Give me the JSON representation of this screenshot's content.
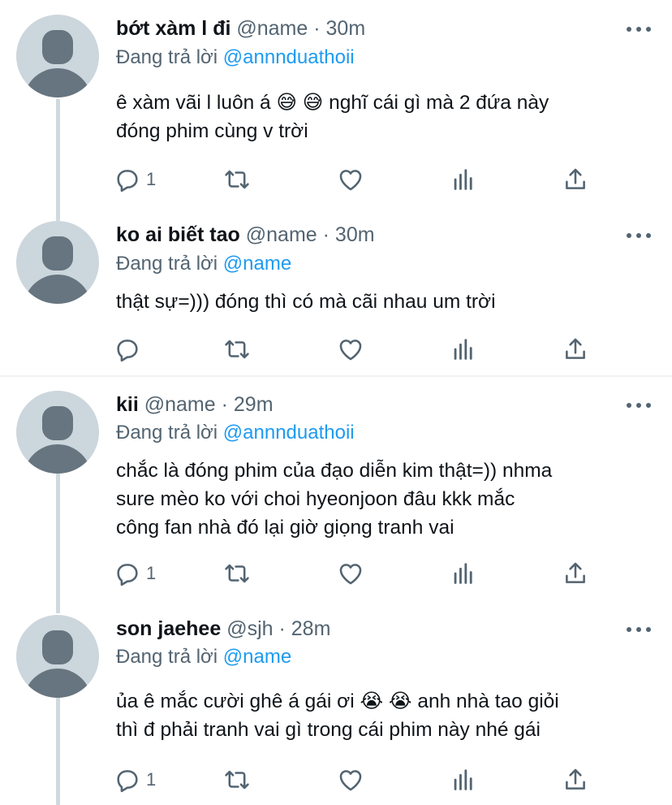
{
  "tweets": [
    {
      "name": "bớt xàm l đi",
      "handle": "@name",
      "time": "· 30m",
      "reply_prefix": "Đang trả lời",
      "reply_to": "@annnduathoii",
      "lines": [
        "ê xàm vãi l luôn á 😅 😅  nghĩ cái gì mà 2 đứa này",
        "đóng phim cùng v trời"
      ],
      "reply_count": "1"
    },
    {
      "name": "ko ai biết tao",
      "handle": "@name",
      "time": "· 30m",
      "reply_prefix": "Đang trả lời",
      "reply_to": "@name",
      "lines": [
        "thật sự=))) đóng thì có mà cãi nhau um trời"
      ],
      "reply_count": ""
    },
    {
      "name": "kii",
      "handle": "@name",
      "time": "· 29m",
      "reply_prefix": "Đang trả lời",
      "reply_to": "@annnduathoii",
      "lines": [
        "chắc là đóng phim của đạo diễn kim thật=)) nhma",
        "sure mèo ko với choi hyeonjoon đâu kkk mắc",
        "công fan nhà đó lại giờ giọng tranh vai"
      ],
      "reply_count": "1"
    },
    {
      "name": "son jaehee",
      "handle": "@sjh",
      "time": "· 28m",
      "reply_prefix": "Đang trả lời",
      "reply_to": "@name",
      "lines": [
        "ủa ê mắc cười ghê á gái ơi 😭 😭  anh nhà tao giỏi",
        "thì đ phải tranh vai gì trong cái phim này nhé gái"
      ],
      "reply_count": "1"
    }
  ],
  "icons": {
    "reply": "reply-icon",
    "retweet": "retweet-icon",
    "like": "like-icon",
    "stats": "stats-icon",
    "share": "share-icon",
    "more": "more-icon"
  },
  "colors": {
    "text": "#0f1419",
    "muted": "#536471",
    "link": "#1d9bf0",
    "avatar_bg": "#ccd6dd",
    "avatar_fg": "#66757f",
    "thread_line": "#cfd9de"
  }
}
